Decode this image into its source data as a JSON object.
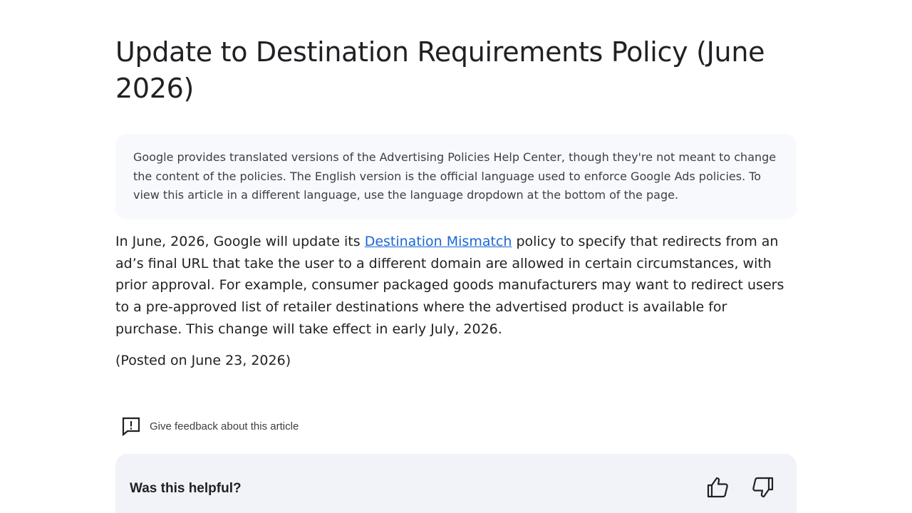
{
  "article": {
    "title": "Update to Destination Requirements Policy (June 2026)",
    "notice": "Google provides translated versions of the Advertising Policies Help Center, though they're not meant to change the content of the policies. The English version is the official language used to enforce Google Ads policies. To view this article in a different language, use the language dropdown at the bottom of the page.",
    "body_before_link": "In June, 2026, Google will update its ",
    "body_link": "Destination Mismatch",
    "body_after_link": " policy to specify that redirects from an ad’s final URL that take the user to a different domain are allowed in certain circumstances, with prior approval. For example, consumer packaged goods manufacturers may want to redirect users to a pre-approved list of retailer destinations where the advertised product is available for purchase. This change will take effect in early July, 2026.",
    "posted": "(Posted on June 23, 2026)"
  },
  "feedback": {
    "label": "Give feedback about this article",
    "icon": "feedback-icon"
  },
  "helpful": {
    "question": "Was this helpful?",
    "up_icon": "thumb-up-icon",
    "down_icon": "thumb-down-icon"
  },
  "colors": {
    "link": "#1a66d4",
    "notice_bg": "#f8f9fc",
    "helpful_bg": "#f1f3f8"
  }
}
